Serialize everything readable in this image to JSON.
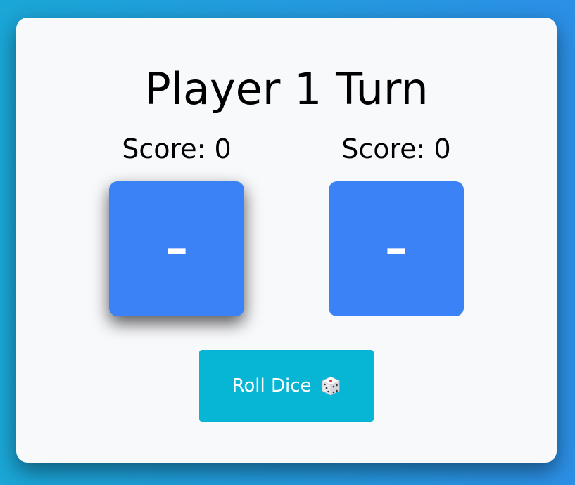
{
  "game": {
    "turn_title": "Player 1 Turn",
    "players": [
      {
        "score_label": "Score: 0",
        "die_value": "–"
      },
      {
        "score_label": "Score: 0",
        "die_value": "–"
      }
    ],
    "active_player": 1,
    "roll_button_label": "Roll Dice",
    "roll_button_icon": "dice-icon"
  },
  "colors": {
    "background_gradient": [
      "#1aa6d6",
      "#2c8fe6"
    ],
    "card": "#f8f9fb",
    "die": "#3b82f6",
    "button": "#06b6d4"
  }
}
